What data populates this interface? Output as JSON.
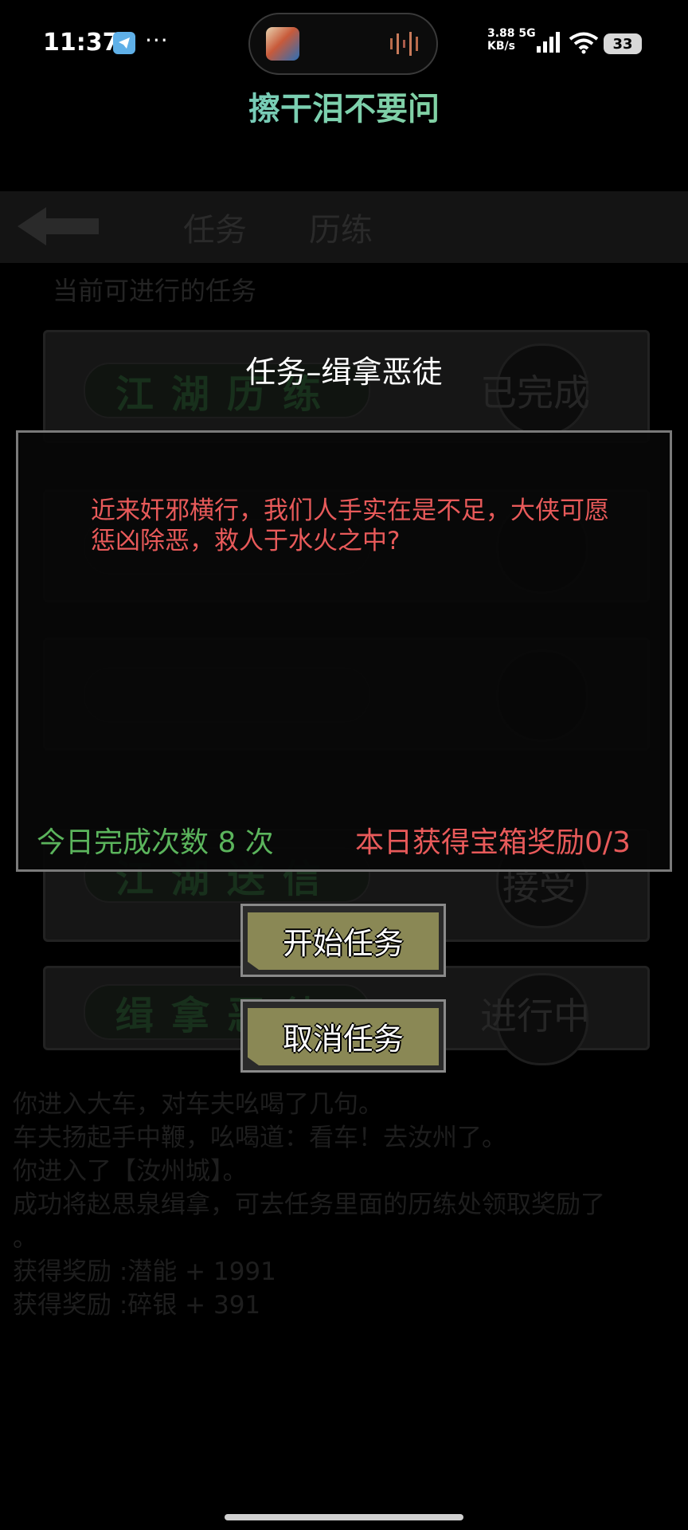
{
  "status_bar": {
    "time": "11:37",
    "dots": "···",
    "net_speed_value": "3.88",
    "net_speed_unit": "KB/s",
    "network": "5G",
    "battery": "33",
    "icons": [
      "telegram-icon",
      "music-wave-icon",
      "signal-icon",
      "wifi-icon",
      "battery-icon"
    ]
  },
  "now_playing": {
    "title": "擦干泪不要问"
  },
  "background_screen": {
    "tabs": [
      "任务",
      "历练"
    ],
    "subtitle": "当前可进行的任务",
    "cards": [
      {
        "name": "江湖历练",
        "status": "已完成"
      },
      {
        "name": "",
        "status": ""
      },
      {
        "name": "",
        "status": ""
      },
      {
        "name": "江湖送信",
        "status": "接受"
      },
      {
        "name": "缉拿恶徒",
        "status": "进行中"
      }
    ],
    "log": [
      "你进入大车，对车夫吆喝了几句。",
      "车夫扬起手中鞭，吆喝道：看车！去汝州了。",
      "你进入了【汝州城】。",
      "成功将赵思泉缉拿，可去任务里面的历练处领取奖励了",
      "。",
      "获得奖励 :潜能 + 1991",
      "获得奖励 :碎银 + 391"
    ]
  },
  "dialog": {
    "title": "任务–缉拿恶徒",
    "description": "近来奸邪横行，我们人手实在是不足，大侠可愿惩凶除恶，救人于水火之中?",
    "daily_count": "今日完成次数 8 次",
    "chest_reward": "本日获得宝箱奖励0/3",
    "start_button": "开始任务",
    "cancel_button": "取消任务"
  },
  "colors": {
    "dialog_text": "#e85a5a",
    "count_text": "#5bb45c",
    "button_face": "#8a8855"
  }
}
